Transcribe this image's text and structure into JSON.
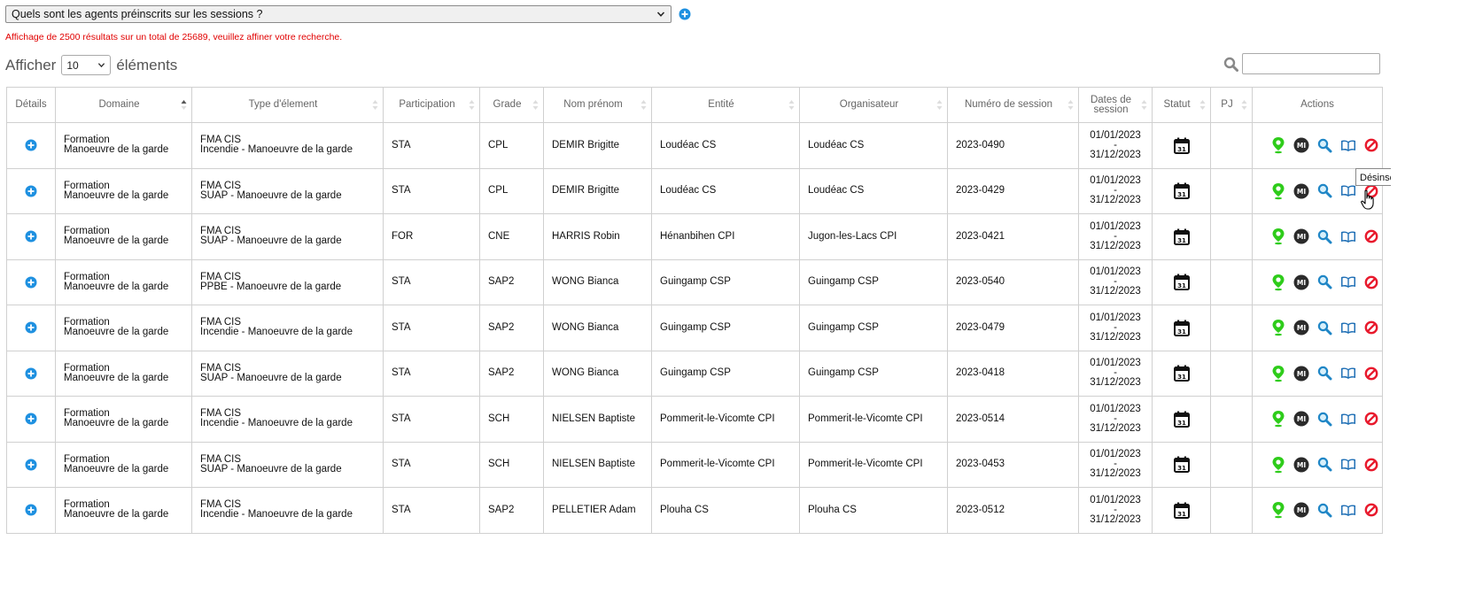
{
  "query": {
    "selected": "Quels sont les agents préinscrits sur les sessions ?"
  },
  "result_info": "Affichage de 2500 résultats sur un total de 25689, veuillez affiner votre recherche.",
  "length": {
    "prefix": "Afficher",
    "value": "10",
    "suffix": "éléments"
  },
  "table": {
    "headers": {
      "details": "Détails",
      "domaine": "Domaine",
      "type": "Type d'élement",
      "participation": "Participation",
      "grade": "Grade",
      "nom": "Nom prénom",
      "entite": "Entité",
      "organisateur": "Organisateur",
      "numero": "Numéro de session",
      "dates1": "Dates de",
      "dates2": "session",
      "statut": "Statut",
      "pj": "PJ",
      "actions": "Actions"
    },
    "date_separator": "-",
    "rows": [
      {
        "domaine1": "Formation",
        "domaine2": "Manoeuvre de la garde",
        "type1": "FMA CIS",
        "type2": "Incendie - Manoeuvre de la garde",
        "participation": "STA",
        "grade": "CPL",
        "nom": "DEMIR Brigitte",
        "entite": "Loudéac CS",
        "organisateur": "Loudéac CS",
        "numero": "2023-0490",
        "date_start": "01/01/2023",
        "date_end": "31/12/2023"
      },
      {
        "domaine1": "Formation",
        "domaine2": "Manoeuvre de la garde",
        "type1": "FMA CIS",
        "type2": "SUAP - Manoeuvre de la garde",
        "participation": "STA",
        "grade": "CPL",
        "nom": "DEMIR Brigitte",
        "entite": "Loudéac CS",
        "organisateur": "Loudéac CS",
        "numero": "2023-0429",
        "date_start": "01/01/2023",
        "date_end": "31/12/2023"
      },
      {
        "domaine1": "Formation",
        "domaine2": "Manoeuvre de la garde",
        "type1": "FMA CIS",
        "type2": "SUAP - Manoeuvre de la garde",
        "participation": "FOR",
        "grade": "CNE",
        "nom": "HARRIS Robin",
        "entite": "Hénanbihen CPI",
        "organisateur": "Jugon-les-Lacs CPI",
        "numero": "2023-0421",
        "date_start": "01/01/2023",
        "date_end": "31/12/2023"
      },
      {
        "domaine1": "Formation",
        "domaine2": "Manoeuvre de la garde",
        "type1": "FMA CIS",
        "type2": "PPBE - Manoeuvre de la garde",
        "participation": "STA",
        "grade": "SAP2",
        "nom": "WONG Bianca",
        "entite": "Guingamp CSP",
        "organisateur": "Guingamp CSP",
        "numero": "2023-0540",
        "date_start": "01/01/2023",
        "date_end": "31/12/2023"
      },
      {
        "domaine1": "Formation",
        "domaine2": "Manoeuvre de la garde",
        "type1": "FMA CIS",
        "type2": "Incendie - Manoeuvre de la garde",
        "participation": "STA",
        "grade": "SAP2",
        "nom": "WONG Bianca",
        "entite": "Guingamp CSP",
        "organisateur": "Guingamp CSP",
        "numero": "2023-0479",
        "date_start": "01/01/2023",
        "date_end": "31/12/2023"
      },
      {
        "domaine1": "Formation",
        "domaine2": "Manoeuvre de la garde",
        "type1": "FMA CIS",
        "type2": "SUAP - Manoeuvre de la garde",
        "participation": "STA",
        "grade": "SAP2",
        "nom": "WONG Bianca",
        "entite": "Guingamp CSP",
        "organisateur": "Guingamp CSP",
        "numero": "2023-0418",
        "date_start": "01/01/2023",
        "date_end": "31/12/2023"
      },
      {
        "domaine1": "Formation",
        "domaine2": "Manoeuvre de la garde",
        "type1": "FMA CIS",
        "type2": "Incendie - Manoeuvre de la garde",
        "participation": "STA",
        "grade": "SCH",
        "nom": "NIELSEN Baptiste",
        "entite": "Pommerit-le-Vicomte CPI",
        "organisateur": "Pommerit-le-Vicomte CPI",
        "numero": "2023-0514",
        "date_start": "01/01/2023",
        "date_end": "31/12/2023"
      },
      {
        "domaine1": "Formation",
        "domaine2": "Manoeuvre de la garde",
        "type1": "FMA CIS",
        "type2": "SUAP - Manoeuvre de la garde",
        "participation": "STA",
        "grade": "SCH",
        "nom": "NIELSEN Baptiste",
        "entite": "Pommerit-le-Vicomte CPI",
        "organisateur": "Pommerit-le-Vicomte CPI",
        "numero": "2023-0453",
        "date_start": "01/01/2023",
        "date_end": "31/12/2023"
      },
      {
        "domaine1": "Formation",
        "domaine2": "Manoeuvre de la garde",
        "type1": "FMA CIS",
        "type2": "Incendie - Manoeuvre de la garde",
        "participation": "STA",
        "grade": "SAP2",
        "nom": "PELLETIER Adam",
        "entite": "Plouha CS",
        "organisateur": "Plouha CS",
        "numero": "2023-0512",
        "date_start": "01/01/2023",
        "date_end": "31/12/2023"
      }
    ]
  },
  "status_icon_text": "31",
  "mi_icon_text": "MI",
  "tooltip": "Désinscrire",
  "icons": {
    "details": "plus-circle-icon",
    "statut": "calendar-icon",
    "actions": [
      "map-pin-icon",
      "mi-badge-icon",
      "magnifier-icon",
      "book-icon",
      "prohibit-icon"
    ],
    "search": "magnifier-icon"
  },
  "colors": {
    "accent": "#1e90e0",
    "error": "#e10000",
    "pin": "#2ecc1a",
    "prohibit": "#e8192c",
    "book": "#1f6fb5"
  }
}
